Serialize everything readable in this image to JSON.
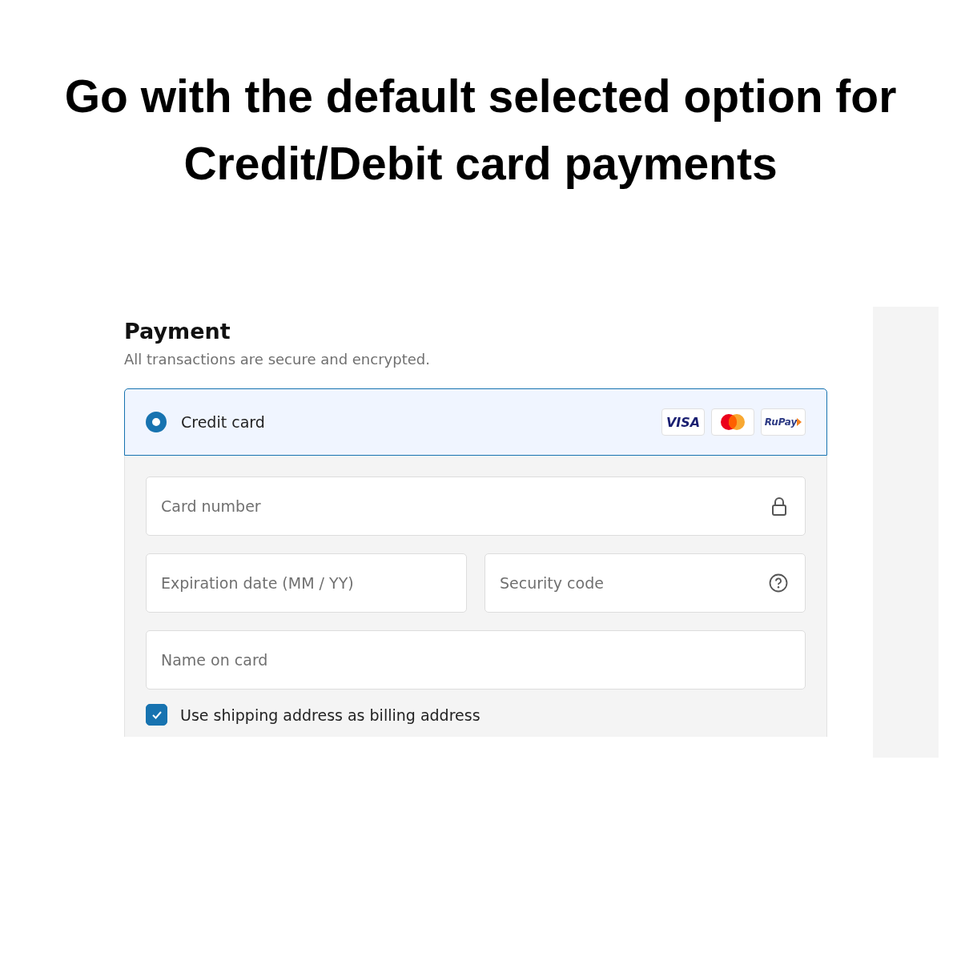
{
  "caption": "Go with the default selected option for Credit/Debit card payments",
  "payment": {
    "title": "Payment",
    "subtitle": "All transactions are secure and encrypted.",
    "method": {
      "label": "Credit card",
      "selected": true,
      "brands": [
        {
          "kind": "visa",
          "text": "VISA"
        },
        {
          "kind": "mastercard"
        },
        {
          "kind": "rupay",
          "text": "RuPay"
        }
      ]
    },
    "fields": [
      {
        "placeholder": "Card number",
        "kind": "lock"
      },
      {
        "placeholder": "Expiration date (MM / YY)",
        "kind": "plain"
      },
      {
        "placeholder": "Security code",
        "kind": "help"
      },
      {
        "placeholder": "Name on card",
        "kind": "plain"
      }
    ],
    "billing_checkbox": {
      "label": "Use shipping address as billing address",
      "checked": true
    }
  }
}
